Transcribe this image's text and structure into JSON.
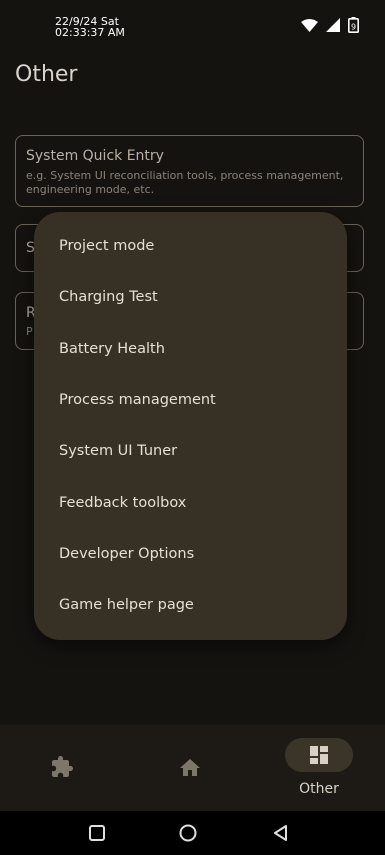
{
  "status_bar": {
    "date": "22/9/24 Sat",
    "time": "02:33:37 AM",
    "battery_level": "9"
  },
  "page": {
    "title": "Other"
  },
  "cards": [
    {
      "title": "System Quick Entry",
      "subtitle": "e.g. System UI reconciliation tools, process management, engineering mode, etc."
    },
    {
      "title": "S"
    },
    {
      "title": "R",
      "subtitle": "P"
    }
  ],
  "menu": {
    "items": [
      {
        "label": "Project mode"
      },
      {
        "label": "Charging Test"
      },
      {
        "label": "Battery Health"
      },
      {
        "label": "Process management"
      },
      {
        "label": "System UI Tuner"
      },
      {
        "label": "Feedback toolbox"
      },
      {
        "label": "Developer Options"
      },
      {
        "label": "Game helper page"
      }
    ]
  },
  "bottom_nav": {
    "items": [
      {
        "icon": "puzzle-icon",
        "label": ""
      },
      {
        "icon": "home-icon",
        "label": ""
      },
      {
        "icon": "dashboard-icon",
        "label": "Other",
        "active": true
      }
    ]
  },
  "system_nav": {
    "icons": [
      "square-recents-icon",
      "circle-home-icon",
      "triangle-back-icon"
    ]
  },
  "colors": {
    "background": "#151310",
    "menu": "#373125",
    "nav_bar": "#1d1a15",
    "active_pill": "#3b3529"
  }
}
